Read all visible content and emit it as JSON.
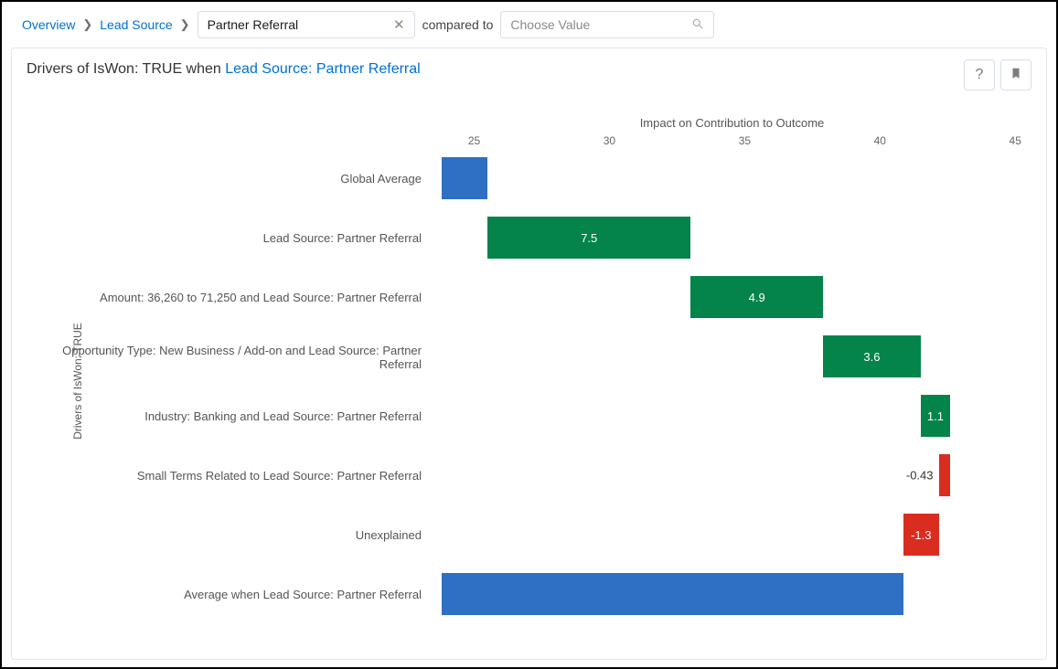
{
  "breadcrumb": {
    "overview": "Overview",
    "lead_source": "Lead Source",
    "selected_value": "Partner Referral",
    "compared_to": "compared to",
    "choose_placeholder": "Choose Value"
  },
  "card": {
    "title_prefix": "Drivers of IsWon: TRUE when ",
    "title_link": "Lead Source: Partner Referral"
  },
  "chart_data": {
    "type": "bar",
    "orientation": "horizontal-waterfall",
    "xlabel": "Impact on Contribution to Outcome",
    "ylabel": "Drivers of IsWon: TRUE",
    "xlim": [
      23.8,
      45.6
    ],
    "xticks": [
      25,
      30,
      35,
      40,
      45
    ],
    "categories": [
      "Global Average",
      "Lead Source: Partner Referral",
      "Amount: 36,260 to 71,250 and Lead Source: Partner Referral",
      "Opportunity Type: New Business / Add-on and Lead Source: Partner Referral",
      "Industry: Banking and Lead Source: Partner Referral",
      "Small Terms Related to Lead Source: Partner Referral",
      "Unexplained",
      "Average when Lead Source: Partner Referral"
    ],
    "bars": [
      {
        "start": 23.8,
        "end": 25.5,
        "color": "blue",
        "label": ""
      },
      {
        "start": 25.5,
        "end": 33.0,
        "color": "green",
        "label": "7.5"
      },
      {
        "start": 33.0,
        "end": 37.9,
        "color": "green",
        "label": "4.9"
      },
      {
        "start": 37.9,
        "end": 41.5,
        "color": "green",
        "label": "3.6"
      },
      {
        "start": 41.5,
        "end": 42.6,
        "color": "green",
        "label": "1.1"
      },
      {
        "start": 42.17,
        "end": 42.6,
        "color": "red",
        "label": "-0.43",
        "label_outside": true
      },
      {
        "start": 40.87,
        "end": 42.17,
        "color": "red",
        "label": "-1.3"
      },
      {
        "start": 23.8,
        "end": 40.87,
        "color": "blue",
        "label": ""
      }
    ]
  }
}
